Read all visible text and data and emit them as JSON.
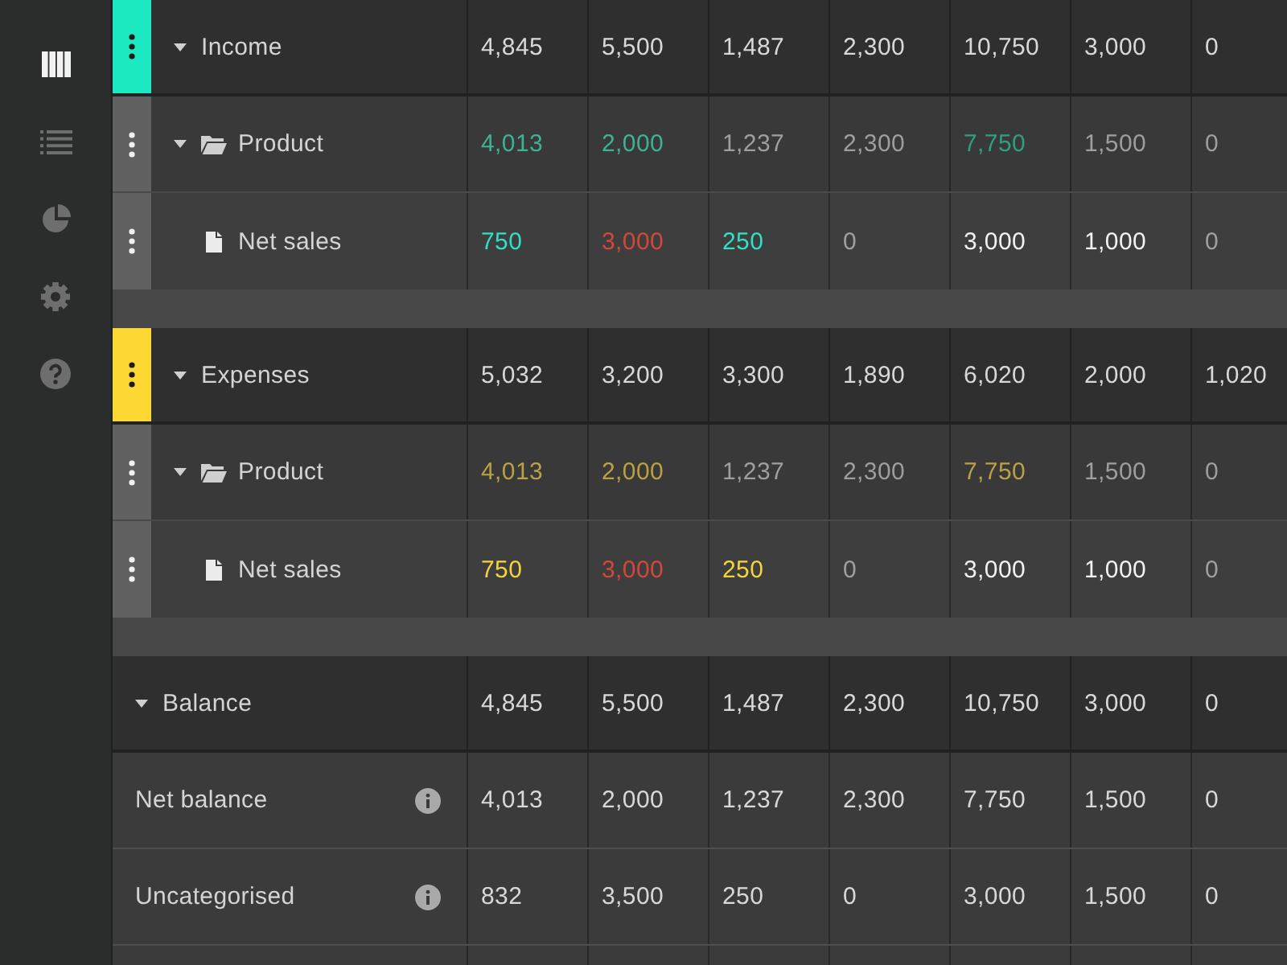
{
  "sidebar": {
    "items": [
      {
        "kind": "columns",
        "selected": true
      },
      {
        "kind": "list",
        "selected": false
      },
      {
        "kind": "chart",
        "selected": false
      },
      {
        "kind": "settings",
        "selected": false
      },
      {
        "kind": "help",
        "selected": false
      }
    ]
  },
  "table": {
    "groups": [
      {
        "kind": "category",
        "label": "Income",
        "color": "#1de9c0",
        "expanded": true,
        "cells": [
          "4,845",
          "5,500",
          "1,487",
          "2,300",
          "10,750",
          "3,000",
          "0"
        ],
        "children": [
          {
            "kind": "folder",
            "label": "Product",
            "expanded": true,
            "cells": [
              {
                "text": "4,013",
                "color": "#3bb394"
              },
              {
                "text": "2,000",
                "color": "#3bb394"
              },
              {
                "text": "1,237",
                "color": "#9e9e9e"
              },
              {
                "text": "2,300",
                "color": "#9e9e9e"
              },
              {
                "text": "7,750",
                "color": "#2f9f82"
              },
              {
                "text": "1,500",
                "color": "#9e9e9e"
              },
              {
                "text": "0",
                "color": "#9e9e9e"
              }
            ],
            "children": [
              {
                "kind": "file",
                "label": "Net sales",
                "cells": [
                  {
                    "text": "750",
                    "color": "#2fe0c2"
                  },
                  {
                    "text": "3,000",
                    "color": "#d5473a"
                  },
                  {
                    "text": "250",
                    "color": "#2fe0c2"
                  },
                  {
                    "text": "0",
                    "color": "#a0a0a0"
                  },
                  {
                    "text": "3,000",
                    "color": "#f2f2f2"
                  },
                  {
                    "text": "1,000",
                    "color": "#f2f2f2"
                  },
                  {
                    "text": "0",
                    "color": "#a0a0a0"
                  }
                ]
              }
            ]
          }
        ]
      },
      {
        "kind": "category",
        "label": "Expenses",
        "color": "#fdd835",
        "expanded": true,
        "cells": [
          "5,032",
          "3,200",
          "3,300",
          "1,890",
          "6,020",
          "2,000",
          "1,020"
        ],
        "children": [
          {
            "kind": "folder",
            "label": "Product",
            "expanded": true,
            "cells": [
              {
                "text": "4,013",
                "color": "#b9a144"
              },
              {
                "text": "2,000",
                "color": "#b9a144"
              },
              {
                "text": "1,237",
                "color": "#9e9e9e"
              },
              {
                "text": "2,300",
                "color": "#9e9e9e"
              },
              {
                "text": "7,750",
                "color": "#b9a144"
              },
              {
                "text": "1,500",
                "color": "#9e9e9e"
              },
              {
                "text": "0",
                "color": "#9e9e9e"
              }
            ],
            "children": [
              {
                "kind": "file",
                "label": "Net sales",
                "cells": [
                  {
                    "text": "750",
                    "color": "#f4d43a"
                  },
                  {
                    "text": "3,000",
                    "color": "#d5473a"
                  },
                  {
                    "text": "250",
                    "color": "#f4d43a"
                  },
                  {
                    "text": "0",
                    "color": "#a0a0a0"
                  },
                  {
                    "text": "3,000",
                    "color": "#f2f2f2"
                  },
                  {
                    "text": "1,000",
                    "color": "#f2f2f2"
                  },
                  {
                    "text": "0",
                    "color": "#a0a0a0"
                  }
                ]
              }
            ]
          }
        ]
      },
      {
        "kind": "summary",
        "label": "Balance",
        "expanded": true,
        "cells": [
          "4,845",
          "5,500",
          "1,487",
          "2,300",
          "10,750",
          "3,000",
          "0"
        ],
        "children": [
          {
            "kind": "info",
            "label": "Net balance",
            "cells": [
              "4,013",
              "2,000",
              "1,237",
              "2,300",
              "7,750",
              "1,500",
              "0"
            ]
          },
          {
            "kind": "info",
            "label": "Uncategorised",
            "cells": [
              "832",
              "3,500",
              "250",
              "0",
              "3,000",
              "1,500",
              "0"
            ]
          }
        ]
      }
    ]
  }
}
